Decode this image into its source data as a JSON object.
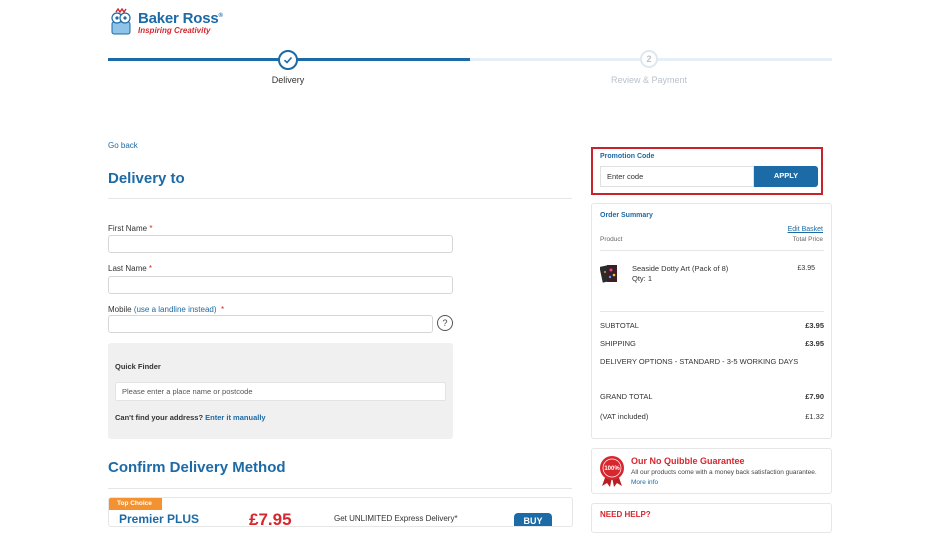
{
  "brand": {
    "name": "Baker Ross",
    "registered": "®",
    "tagline": "Inspiring Creativity"
  },
  "stepper": {
    "step1_label": "Delivery",
    "step2_number": "2",
    "step2_label": "Review & Payment"
  },
  "delivery": {
    "go_back": "Go back",
    "heading": "Delivery to",
    "first_name_label": "First Name",
    "last_name_label": "Last Name",
    "mobile_label": "Mobile",
    "landline_link": "(use a landline instead)",
    "required_mark": "*",
    "help_icon_text": "?"
  },
  "quick_finder": {
    "title": "Quick Finder",
    "placeholder": "Please enter a place name or postcode",
    "cant_find": "Can't find your address?",
    "enter_manually": "Enter it manually"
  },
  "confirm": {
    "heading": "Confirm Delivery Method",
    "badge": "Top Choice",
    "name": "Premier PLUS",
    "price": "£7.95",
    "description": "Get UNLIMITED Express Delivery*",
    "buy": "BUY"
  },
  "promo": {
    "title": "Promotion Code",
    "placeholder": "Enter code",
    "apply": "APPLY"
  },
  "summary": {
    "title": "Order Summary",
    "edit_basket": "Edit Basket",
    "col_product": "Product",
    "col_total": "Total Price",
    "item": {
      "name": "Seaside Dotty Art (Pack of 8)",
      "qty": "Qty: 1",
      "price": "£3.95"
    },
    "subtotal_label": "SUBTOTAL",
    "subtotal": "£3.95",
    "shipping_label": "SHIPPING",
    "shipping": "£3.95",
    "delivery_options": "DELIVERY OPTIONS - STANDARD - 3-5 WORKING DAYS",
    "grand_total_label": "GRAND TOTAL",
    "grand_total": "£7.90",
    "vat_label": "(VAT included)",
    "vat": "£1.32"
  },
  "guarantee": {
    "title": "Our No Quibble Guarantee",
    "text": "All our products come with a money back satisfaction guarantee.",
    "more": "More info",
    "badge_text": "100%"
  },
  "need_help": {
    "title": "NEED HELP?"
  },
  "colors": {
    "brand_blue": "#1c6aa6",
    "brand_red": "#d7262e",
    "highlight_red": "#c8222b",
    "badge_orange": "#f39231"
  }
}
